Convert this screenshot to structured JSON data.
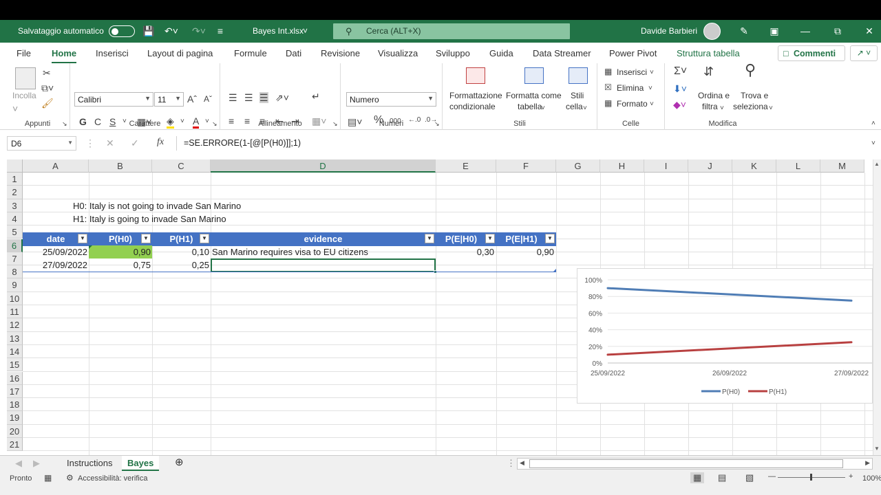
{
  "titlebar": {
    "autosave_label": "Salvataggio automatico",
    "filename": "Bayes Int.xlsx",
    "search_placeholder": "Cerca (ALT+X)",
    "user": "Davide Barbieri"
  },
  "tabs": [
    "File",
    "Home",
    "Inserisci",
    "Layout di pagina",
    "Formule",
    "Dati",
    "Revisione",
    "Visualizza",
    "Sviluppo",
    "Guida",
    "Data Streamer",
    "Power Pivot",
    "Struttura tabella"
  ],
  "comments_label": "Commenti",
  "ribbon": {
    "clipboard": {
      "paste": "Incolla",
      "label": "Appunti"
    },
    "font": {
      "name": "Calibri",
      "size": "11",
      "bold": "G",
      "italic": "C",
      "underline": "S",
      "label": "Carattere"
    },
    "alignment": {
      "label": "Allineamento"
    },
    "number": {
      "format": "Numero",
      "percent": "%",
      "thousands": "000",
      "label": "Numeri"
    },
    "styles": {
      "conditional_1": "Formattazione",
      "conditional_2": "condizionale",
      "table_1": "Formatta come",
      "table_2": "tabella",
      "cell_1": "Stili",
      "cell_2": "cella",
      "label": "Stili"
    },
    "cells": {
      "insert": "Inserisci",
      "delete": "Elimina",
      "format": "Formato",
      "label": "Celle"
    },
    "editing": {
      "sort_1": "Ordina e",
      "sort_2": "filtra",
      "find_1": "Trova e",
      "find_2": "seleziona",
      "label": "Modifica"
    }
  },
  "formula_bar": {
    "name_box": "D6",
    "fx": "fx",
    "formula": "=SE.ERRORE(1-[@[P(H0)]];1)"
  },
  "columns": [
    "A",
    "B",
    "C",
    "D",
    "E",
    "F",
    "G",
    "H",
    "I",
    "J",
    "K",
    "L",
    "M"
  ],
  "rows": [
    "1",
    "2",
    "3",
    "4",
    "5",
    "6",
    "7",
    "8",
    "9",
    "10",
    "11",
    "12",
    "13",
    "14",
    "15",
    "16",
    "17",
    "18",
    "19",
    "20",
    "21"
  ],
  "cells": {
    "h0_text": "H0:  Italy is not going to invade San Marino",
    "h1_text": "H1:  Italy is going to invade San Marino",
    "table_headers": [
      "date",
      "P(H0)",
      "P(H1)",
      "evidence",
      "P(E|H0)",
      "P(E|H1)"
    ],
    "table_rows": [
      [
        "25/09/2022",
        "0,90",
        "0,10",
        "San Marino requires visa to EU citizens",
        "0,30",
        "0,90"
      ],
      [
        "27/09/2022",
        "0,75",
        "0,25",
        "",
        "",
        ""
      ]
    ]
  },
  "chart_data": {
    "type": "line",
    "x": [
      "25/09/2022",
      "26/09/2022",
      "27/09/2022"
    ],
    "x_values": [
      "25/09/2022",
      "27/09/2022"
    ],
    "series": [
      {
        "name": "P(H0)",
        "values": [
          0.9,
          0.75
        ],
        "color": "#4f7db5"
      },
      {
        "name": "P(H1)",
        "values": [
          0.1,
          0.25
        ],
        "color": "#b84040"
      }
    ],
    "yticks": [
      "0%",
      "20%",
      "40%",
      "60%",
      "80%",
      "100%"
    ],
    "ylim": [
      0,
      1
    ],
    "legend": "bottom"
  },
  "sheets": [
    "Instructions",
    "Bayes"
  ],
  "status": {
    "ready": "Pronto",
    "accessibility": "Accessibilità: verifica",
    "zoom": "100%"
  }
}
